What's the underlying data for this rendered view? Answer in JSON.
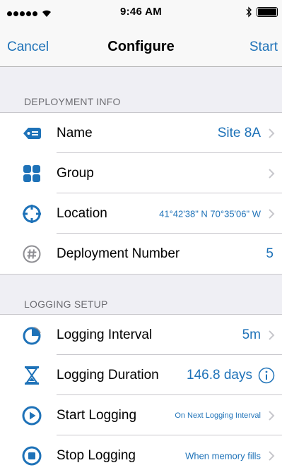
{
  "status_bar": {
    "time": "9:46 AM"
  },
  "nav": {
    "cancel_label": "Cancel",
    "title": "Configure",
    "start_label": "Start"
  },
  "deployment_section": {
    "header": "DEPLOYMENT INFO",
    "rows": [
      {
        "icon": "tag-icon",
        "label": "Name",
        "value": "Site 8A"
      },
      {
        "icon": "grid-icon",
        "label": "Group",
        "value": ""
      },
      {
        "icon": "crosshair-icon",
        "label": "Location",
        "value": "41°42'38\" N 70°35'06\" W"
      },
      {
        "icon": "hash-icon",
        "label": "Deployment Number",
        "value": "5"
      }
    ]
  },
  "logging_section": {
    "header": "LOGGING SETUP",
    "rows": [
      {
        "icon": "interval-clock-icon",
        "label": "Logging Interval",
        "value": "5m"
      },
      {
        "icon": "hourglass-icon",
        "label": "Logging Duration",
        "value": "146.8 days"
      },
      {
        "icon": "play-circle-icon",
        "label": "Start Logging",
        "value": "On Next Logging Interval"
      },
      {
        "icon": "stop-circle-icon",
        "label": "Stop Logging",
        "value": "When memory fills"
      }
    ]
  },
  "colors": {
    "accent": "#1e72b8",
    "background": "#efeff4",
    "header_text": "#6d6d72"
  }
}
